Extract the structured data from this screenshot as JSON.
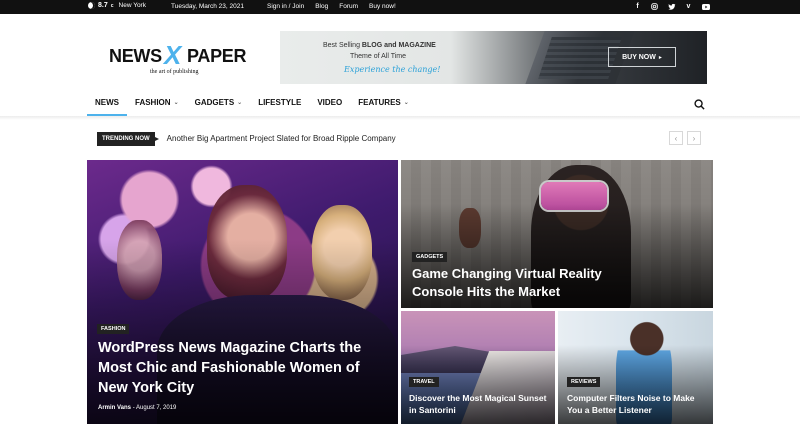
{
  "topbar": {
    "temp": "8.7",
    "deg": "c",
    "city": "New York",
    "date": "Tuesday, March 23, 2021",
    "links": [
      "Sign in / Join",
      "Blog",
      "Forum",
      "Buy now!"
    ],
    "social": [
      "facebook-icon",
      "instagram-icon",
      "twitter-icon",
      "vimeo-icon",
      "youtube-icon"
    ]
  },
  "logo": {
    "word1": "NEWS",
    "x": "X",
    "word2": "PAPER",
    "tagline": "the art of publishing"
  },
  "banner": {
    "line1_pre": "Best Selling ",
    "line1_bold": "BLOG and MAGAZINE",
    "line2": "Theme of All Time",
    "line3": "Experience the change!",
    "button": "BUY NOW"
  },
  "nav": {
    "items": [
      {
        "label": "NEWS",
        "dropdown": false
      },
      {
        "label": "FASHION",
        "dropdown": true
      },
      {
        "label": "GADGETS",
        "dropdown": true
      },
      {
        "label": "LIFESTYLE",
        "dropdown": false
      },
      {
        "label": "VIDEO",
        "dropdown": false
      },
      {
        "label": "FEATURES",
        "dropdown": true
      }
    ]
  },
  "trending": {
    "label": "TRENDING NOW",
    "headline": "Another Big Apartment Project Slated for Broad Ripple Company",
    "prev": "‹",
    "next": "›"
  },
  "featured": {
    "main": {
      "category": "FASHION",
      "title": "WordPress News Magazine Charts the Most Chic and Fashionable Women of New York City",
      "author": "Armin Vans",
      "date": "August 7, 2019"
    },
    "vr": {
      "category": "GADGETS",
      "title": "Game Changing Virtual Reality Console Hits the Market"
    },
    "santorini": {
      "category": "TRAVEL",
      "title": "Discover the Most Magical Sunset in Santorini"
    },
    "reviews": {
      "category": "REVIEWS",
      "title": "Computer Filters Noise to Make You a Better Listener"
    }
  },
  "colors": {
    "accent": "#4db2ec",
    "topbar": "#111111"
  }
}
